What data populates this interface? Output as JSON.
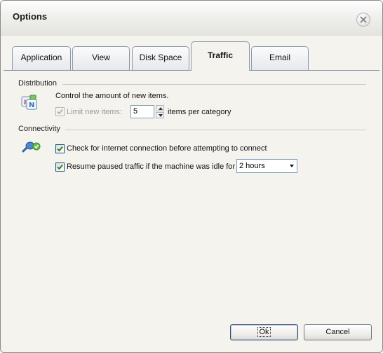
{
  "window": {
    "title": "Options"
  },
  "tabs": [
    {
      "label": "Application"
    },
    {
      "label": "View"
    },
    {
      "label": "Disk Space"
    },
    {
      "label": "Traffic",
      "active": true
    },
    {
      "label": "Email"
    }
  ],
  "distribution": {
    "header": "Distribution",
    "description": "Control the amount of new items.",
    "limit_label": "Limit new items:",
    "limit_checked": true,
    "limit_enabled": false,
    "limit_value": "5",
    "suffix": "items per category"
  },
  "connectivity": {
    "header": "Connectivity",
    "check_internet_label": "Check for internet connection before attempting to connect",
    "check_internet_checked": true,
    "resume_label": "Resume paused traffic if the machine was idle for",
    "resume_checked": true,
    "idle_value": "2 hours"
  },
  "buttons": {
    "ok": "Ok",
    "cancel": "Cancel"
  },
  "colors": {
    "accent_border": "#8c97a8",
    "check_mark": "#1a7b1a",
    "panel_bg": "#f4f3ee"
  }
}
